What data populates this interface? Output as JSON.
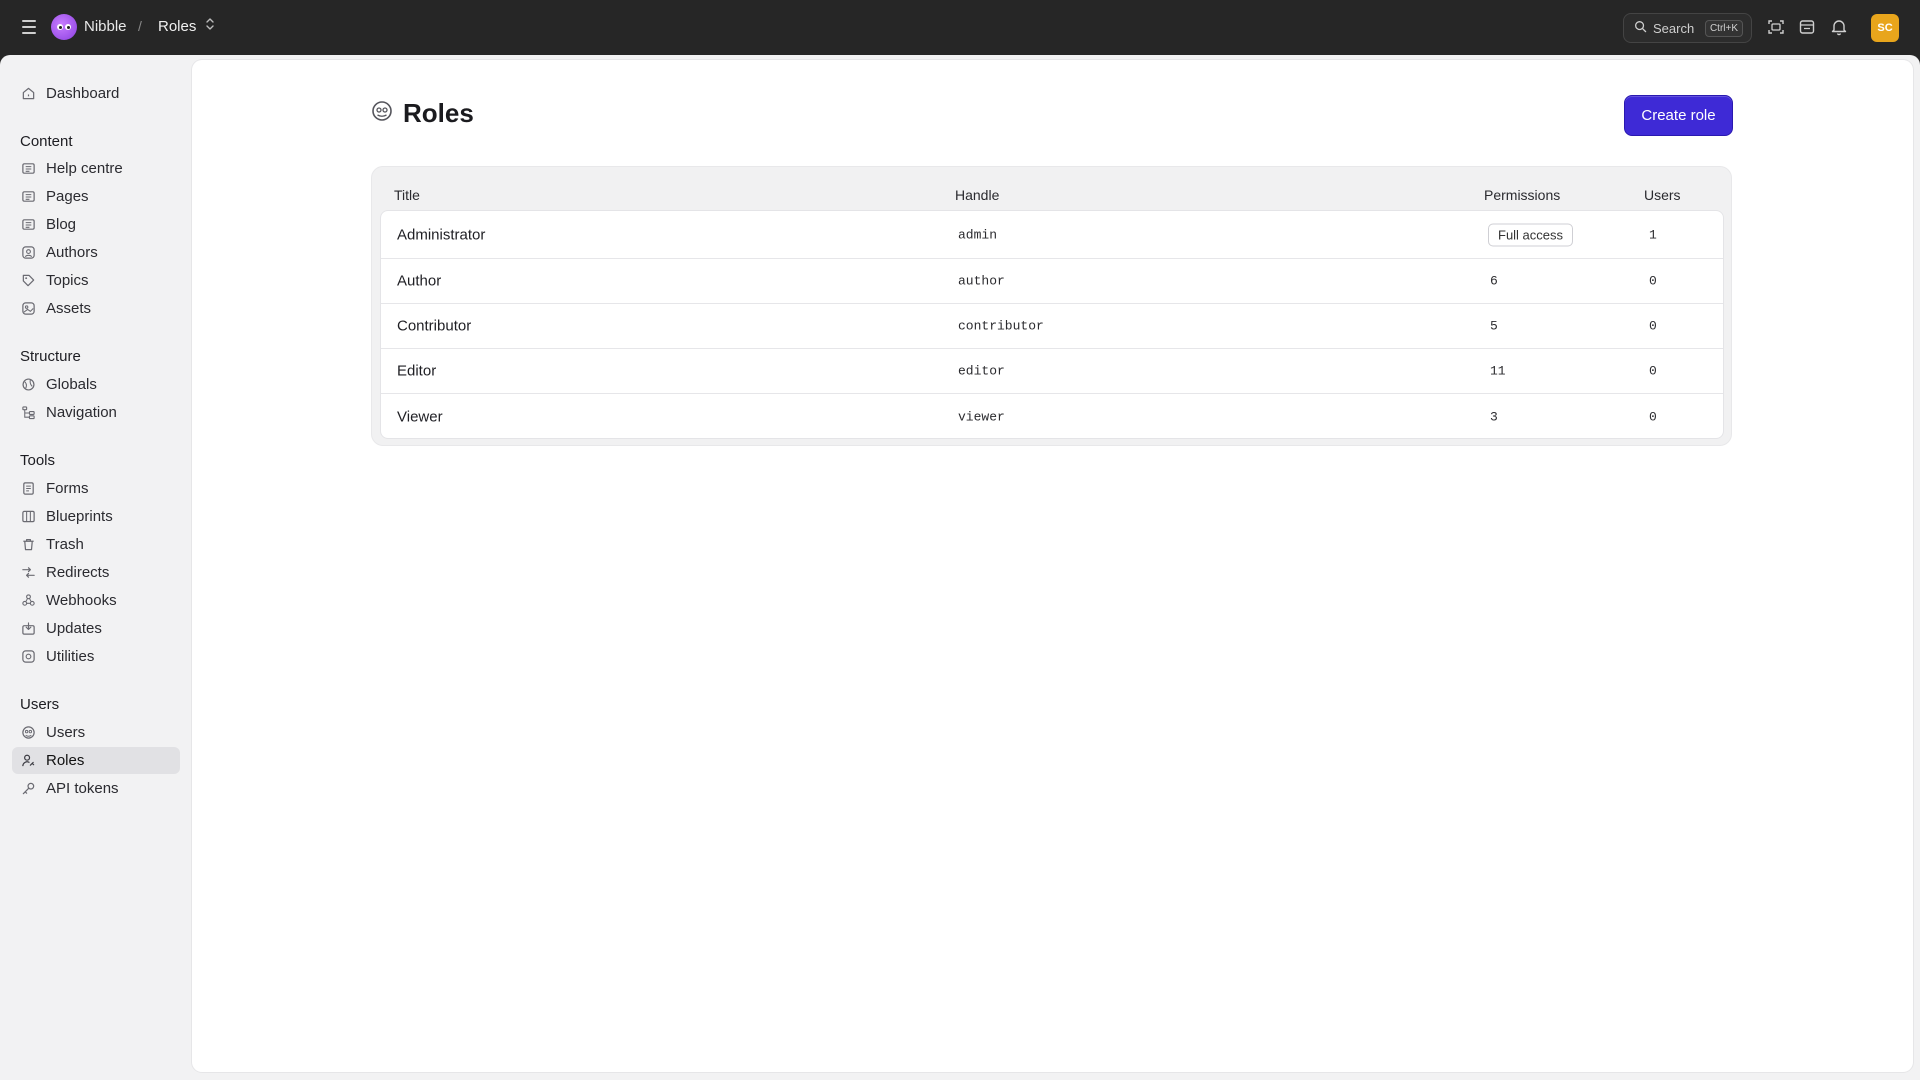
{
  "topbar": {
    "brand": "Nibble",
    "separator": "/",
    "current": "Roles",
    "search_label": "Search",
    "search_shortcut": "Ctrl+K",
    "avatar_initials": "SC",
    "avatar_color": "#e8a51c"
  },
  "sidebar": {
    "dashboard": "Dashboard",
    "sections": {
      "content": "Content",
      "structure": "Structure",
      "tools": "Tools",
      "users": "Users"
    },
    "content_items": [
      "Help centre",
      "Pages",
      "Blog",
      "Authors",
      "Topics",
      "Assets"
    ],
    "structure_items": [
      "Globals",
      "Navigation"
    ],
    "tools_items": [
      "Forms",
      "Blueprints",
      "Trash",
      "Redirects",
      "Webhooks",
      "Updates",
      "Utilities"
    ],
    "users_items": [
      "Users",
      "Roles",
      "API tokens"
    ],
    "active": "Roles"
  },
  "page": {
    "title": "Roles",
    "create_label": "Create role",
    "accent": "#3e2ad6"
  },
  "table": {
    "headers": [
      "Title",
      "Handle",
      "Permissions",
      "Users"
    ],
    "rows": [
      {
        "title": "Administrator",
        "handle": "admin",
        "permissions": "Full access",
        "users": "1"
      },
      {
        "title": "Author",
        "handle": "author",
        "permissions": "6",
        "users": "0"
      },
      {
        "title": "Contributor",
        "handle": "contributor",
        "permissions": "5",
        "users": "0"
      },
      {
        "title": "Editor",
        "handle": "editor",
        "permissions": "11",
        "users": "0"
      },
      {
        "title": "Viewer",
        "handle": "viewer",
        "permissions": "3",
        "users": "0"
      }
    ]
  }
}
